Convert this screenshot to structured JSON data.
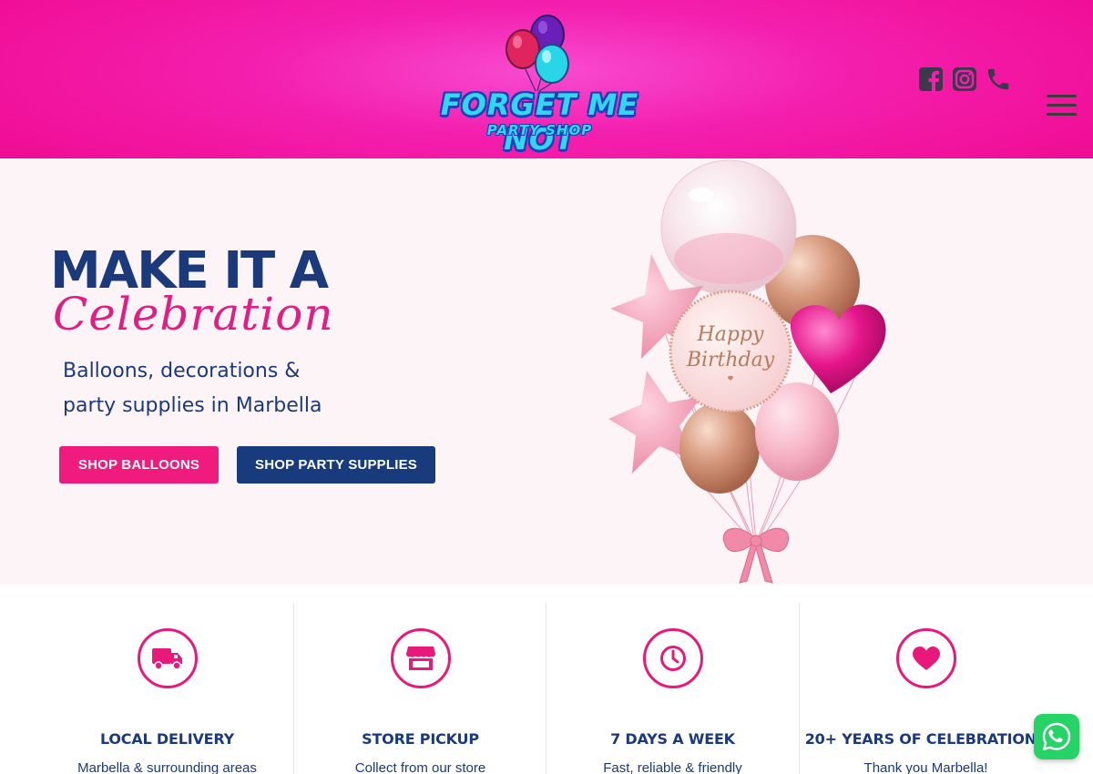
{
  "header": {
    "logo": {
      "title": "FORGET ME NOT",
      "subtitle": "PARTY SHOP"
    },
    "social": [
      {
        "name": "facebook-icon"
      },
      {
        "name": "instagram-icon"
      },
      {
        "name": "phone-icon"
      }
    ],
    "menu_icon": "hamburger-menu-icon"
  },
  "hero": {
    "heading": "MAKE IT A",
    "script": "Celebration",
    "subtitle_line1": "Balloons, decorations &",
    "subtitle_line2": "party supplies in Marbella",
    "btn_balloons": "SHOP BALLOONS",
    "btn_supplies": "SHOP PARTY SUPPLIES",
    "balloon_text_line1": "Happy",
    "balloon_text_line2": "Birthday"
  },
  "features": [
    {
      "icon": "truck-icon",
      "title": "LOCAL DELIVERY",
      "text": "Marbella & surrounding areas"
    },
    {
      "icon": "store-icon",
      "title": "STORE PICKUP",
      "text": "Collect from our store"
    },
    {
      "icon": "clock-icon",
      "title": "7 DAYS A WEEK",
      "text": "Fast, reliable & friendly"
    },
    {
      "icon": "heart-icon",
      "title": "20+ YEARS OF CELEBRATIONS",
      "text": "Thank you Marbella!"
    }
  ],
  "colors": {
    "header_pink": "#f41fae",
    "accent_pink": "#ef1b7d",
    "navy": "#1a3a7c",
    "hero_bg": "#fdf4f7",
    "whatsapp_green": "#25d366"
  },
  "widgets": {
    "chat": "whatsapp-icon"
  }
}
